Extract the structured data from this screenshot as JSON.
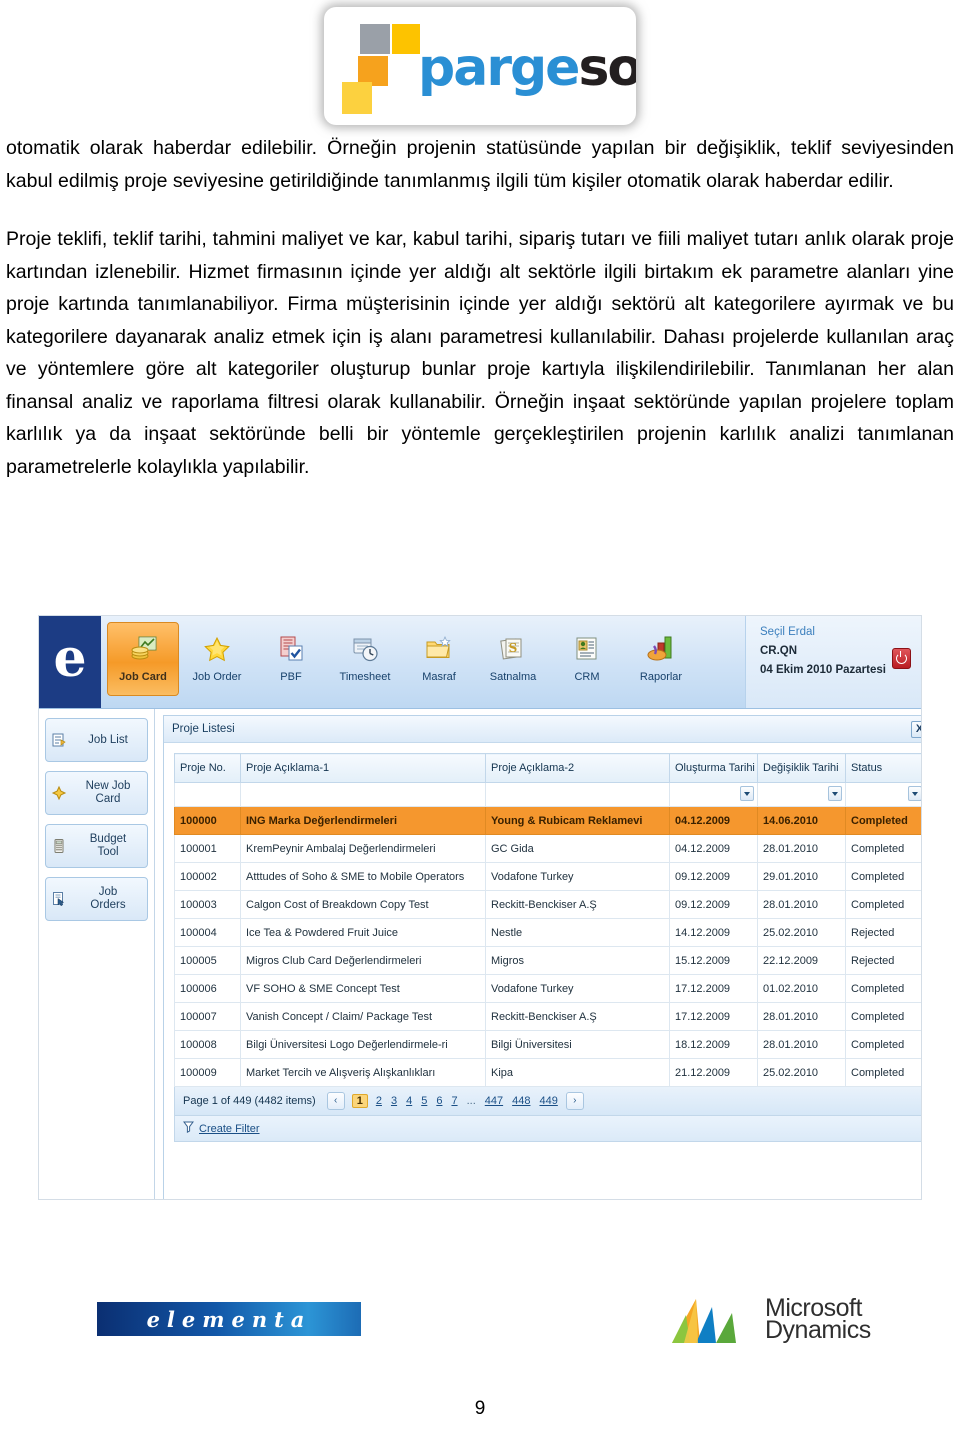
{
  "header": {
    "logo_text_part1": "parge",
    "logo_text_part2": "soft",
    "logo_registered": "®"
  },
  "document": {
    "paragraph1": "otomatik olarak haberdar edilebilir. Örneğin projenin statüsünde yapılan bir değişiklik, teklif seviyesinden kabul edilmiş proje seviyesine getirildiğinde tanımlanmış ilgili tüm kişiler otomatik olarak haberdar edilir.",
    "paragraph2": "Proje teklifi, teklif tarihi, tahmini maliyet ve kar, kabul tarihi, sipariş tutarı ve fiili maliyet tutarı anlık olarak proje kartından izlenebilir. Hizmet firmasının içinde yer aldığı alt sektörle ilgili birtakım ek parametre alanları yine proje kartında tanımlanabiliyor. Firma müşterisinin içinde yer aldığı sektörü alt kategorilere ayırmak ve bu kategorilere dayanarak analiz etmek için iş alanı parametresi kullanılabilir. Dahası projelerde kullanılan araç ve yöntemlere göre alt kategoriler oluşturup bunlar proje kartıyla ilişkilendirilebilir. Tanımlanan her alan finansal analiz ve raporlama filtresi olarak kullanabilir. Örneğin inşaat sektöründe yapılan projelere toplam karlılık ya da inşaat sektöründe belli bir yöntemle gerçekleştirilen projenin karlılık analizi tanımlanan parametrelerle kolaylıkla yapılabilir.",
    "page_number": "9"
  },
  "app": {
    "brand_letter": "e",
    "ribbon_tabs": [
      {
        "label": "Job Card",
        "icon": "coins-chart-icon",
        "active": true
      },
      {
        "label": "Job Order",
        "icon": "star-icon",
        "active": false
      },
      {
        "label": "PBF",
        "icon": "document-check-icon",
        "active": false
      },
      {
        "label": "Timesheet",
        "icon": "clock-book-icon",
        "active": false
      },
      {
        "label": "Masraf",
        "icon": "folder-star-icon",
        "active": false
      },
      {
        "label": "Satnalma",
        "icon": "money-stack-icon",
        "active": false
      },
      {
        "label": "CRM",
        "icon": "contact-card-icon",
        "active": false
      },
      {
        "label": "Raporlar",
        "icon": "bar-chart-icon",
        "active": false
      }
    ],
    "user": {
      "name": "Seçil Erdal",
      "code": "CR.QN",
      "date": "04 Ekim 2010 Pazartesi",
      "logout_icon": "power-icon"
    },
    "sidebar": [
      {
        "label": "Job List",
        "icon": "list-icon"
      },
      {
        "label": "New Job\nCard",
        "label_line1": "New Job",
        "label_line2": "Card",
        "icon": "new-card-icon"
      },
      {
        "label": "Budget\nTool",
        "label_line1": "Budget",
        "label_line2": "Tool",
        "icon": "calculator-icon"
      },
      {
        "label": "Job\nOrders",
        "label_line1": "Job",
        "label_line2": "Orders",
        "icon": "order-cursor-icon"
      }
    ],
    "panel": {
      "title": "Proje Listesi",
      "close_label": "X"
    },
    "grid": {
      "columns": [
        "Proje No.",
        "Proje Açıklama-1",
        "Proje Açıklama-2",
        "Oluşturma Tarihi",
        "Değişiklik Tarihi",
        "Status"
      ],
      "filter_values": [
        "",
        "",
        "",
        "",
        "",
        ""
      ],
      "rows": [
        {
          "no": "100000",
          "d1": "ING Marka Değerlendirmeleri",
          "d2": "Young & Rubicam Reklamevi",
          "created": "04.12.2009",
          "changed": "14.06.2010",
          "status": "Completed",
          "selected": true
        },
        {
          "no": "100001",
          "d1": "KremPeynir Ambalaj Değerlendirmeleri",
          "d2": "GC Gida",
          "created": "04.12.2009",
          "changed": "28.01.2010",
          "status": "Completed",
          "selected": false
        },
        {
          "no": "100002",
          "d1": "Atttudes of Soho & SME to Mobile Operators",
          "d2": "Vodafone Turkey",
          "created": "09.12.2009",
          "changed": "29.01.2010",
          "status": "Completed",
          "selected": false
        },
        {
          "no": "100003",
          "d1": "Calgon Cost of Breakdown Copy Test",
          "d2": "Reckitt-Benckiser A.Ş",
          "created": "09.12.2009",
          "changed": "28.01.2010",
          "status": "Completed",
          "selected": false
        },
        {
          "no": "100004",
          "d1": "Ice Tea & Powdered Fruit Juice",
          "d2": "Nestle",
          "created": "14.12.2009",
          "changed": "25.02.2010",
          "status": "Rejected",
          "selected": false
        },
        {
          "no": "100005",
          "d1": "Migros Club Card Değerlendirmeleri",
          "d2": "Migros",
          "created": "15.12.2009",
          "changed": "22.12.2009",
          "status": "Rejected",
          "selected": false
        },
        {
          "no": "100006",
          "d1": "VF SOHO & SME Concept Test",
          "d2": "Vodafone Turkey",
          "created": "17.12.2009",
          "changed": "01.02.2010",
          "status": "Completed",
          "selected": false
        },
        {
          "no": "100007",
          "d1": "Vanish Concept / Claim/ Package Test",
          "d2": "Reckitt-Benckiser A.Ş",
          "created": "17.12.2009",
          "changed": "28.01.2010",
          "status": "Completed",
          "selected": false
        },
        {
          "no": "100008",
          "d1": "Bilgi Üniversitesi Logo Değerlendirmele-ri",
          "d2": "Bilgi Üniversitesi",
          "created": "18.12.2009",
          "changed": "28.01.2010",
          "status": "Completed",
          "selected": false
        },
        {
          "no": "100009",
          "d1": "Market Tercih ve Alışveriş Alışkanlıkları",
          "d2": "Kipa",
          "created": "21.12.2009",
          "changed": "25.02.2010",
          "status": "Completed",
          "selected": false
        }
      ]
    },
    "pager": {
      "info": "Page 1 of 449 (4482 items)",
      "prev": "‹",
      "next": "›",
      "pages": [
        "1",
        "2",
        "3",
        "4",
        "5",
        "6",
        "7",
        "...",
        "447",
        "448",
        "449"
      ],
      "current": "1"
    },
    "filter_bar": {
      "label": "Create Filter",
      "icon": "funnel-icon"
    }
  },
  "footer": {
    "elementa_text": "elementa",
    "ms_line1": "Microsoft",
    "ms_line2": "Dynamics"
  },
  "colors": {
    "accent_orange": "#f5972e",
    "ribbon_blue": "#cfe2f6",
    "brand_navy": "#1c3c84",
    "link_blue": "#1a4f86",
    "logo_blue": "#2a8fd4",
    "logo_yellow": "#fdc300",
    "logo_orange": "#f6a21d",
    "logo_gray": "#9aa0a8"
  }
}
